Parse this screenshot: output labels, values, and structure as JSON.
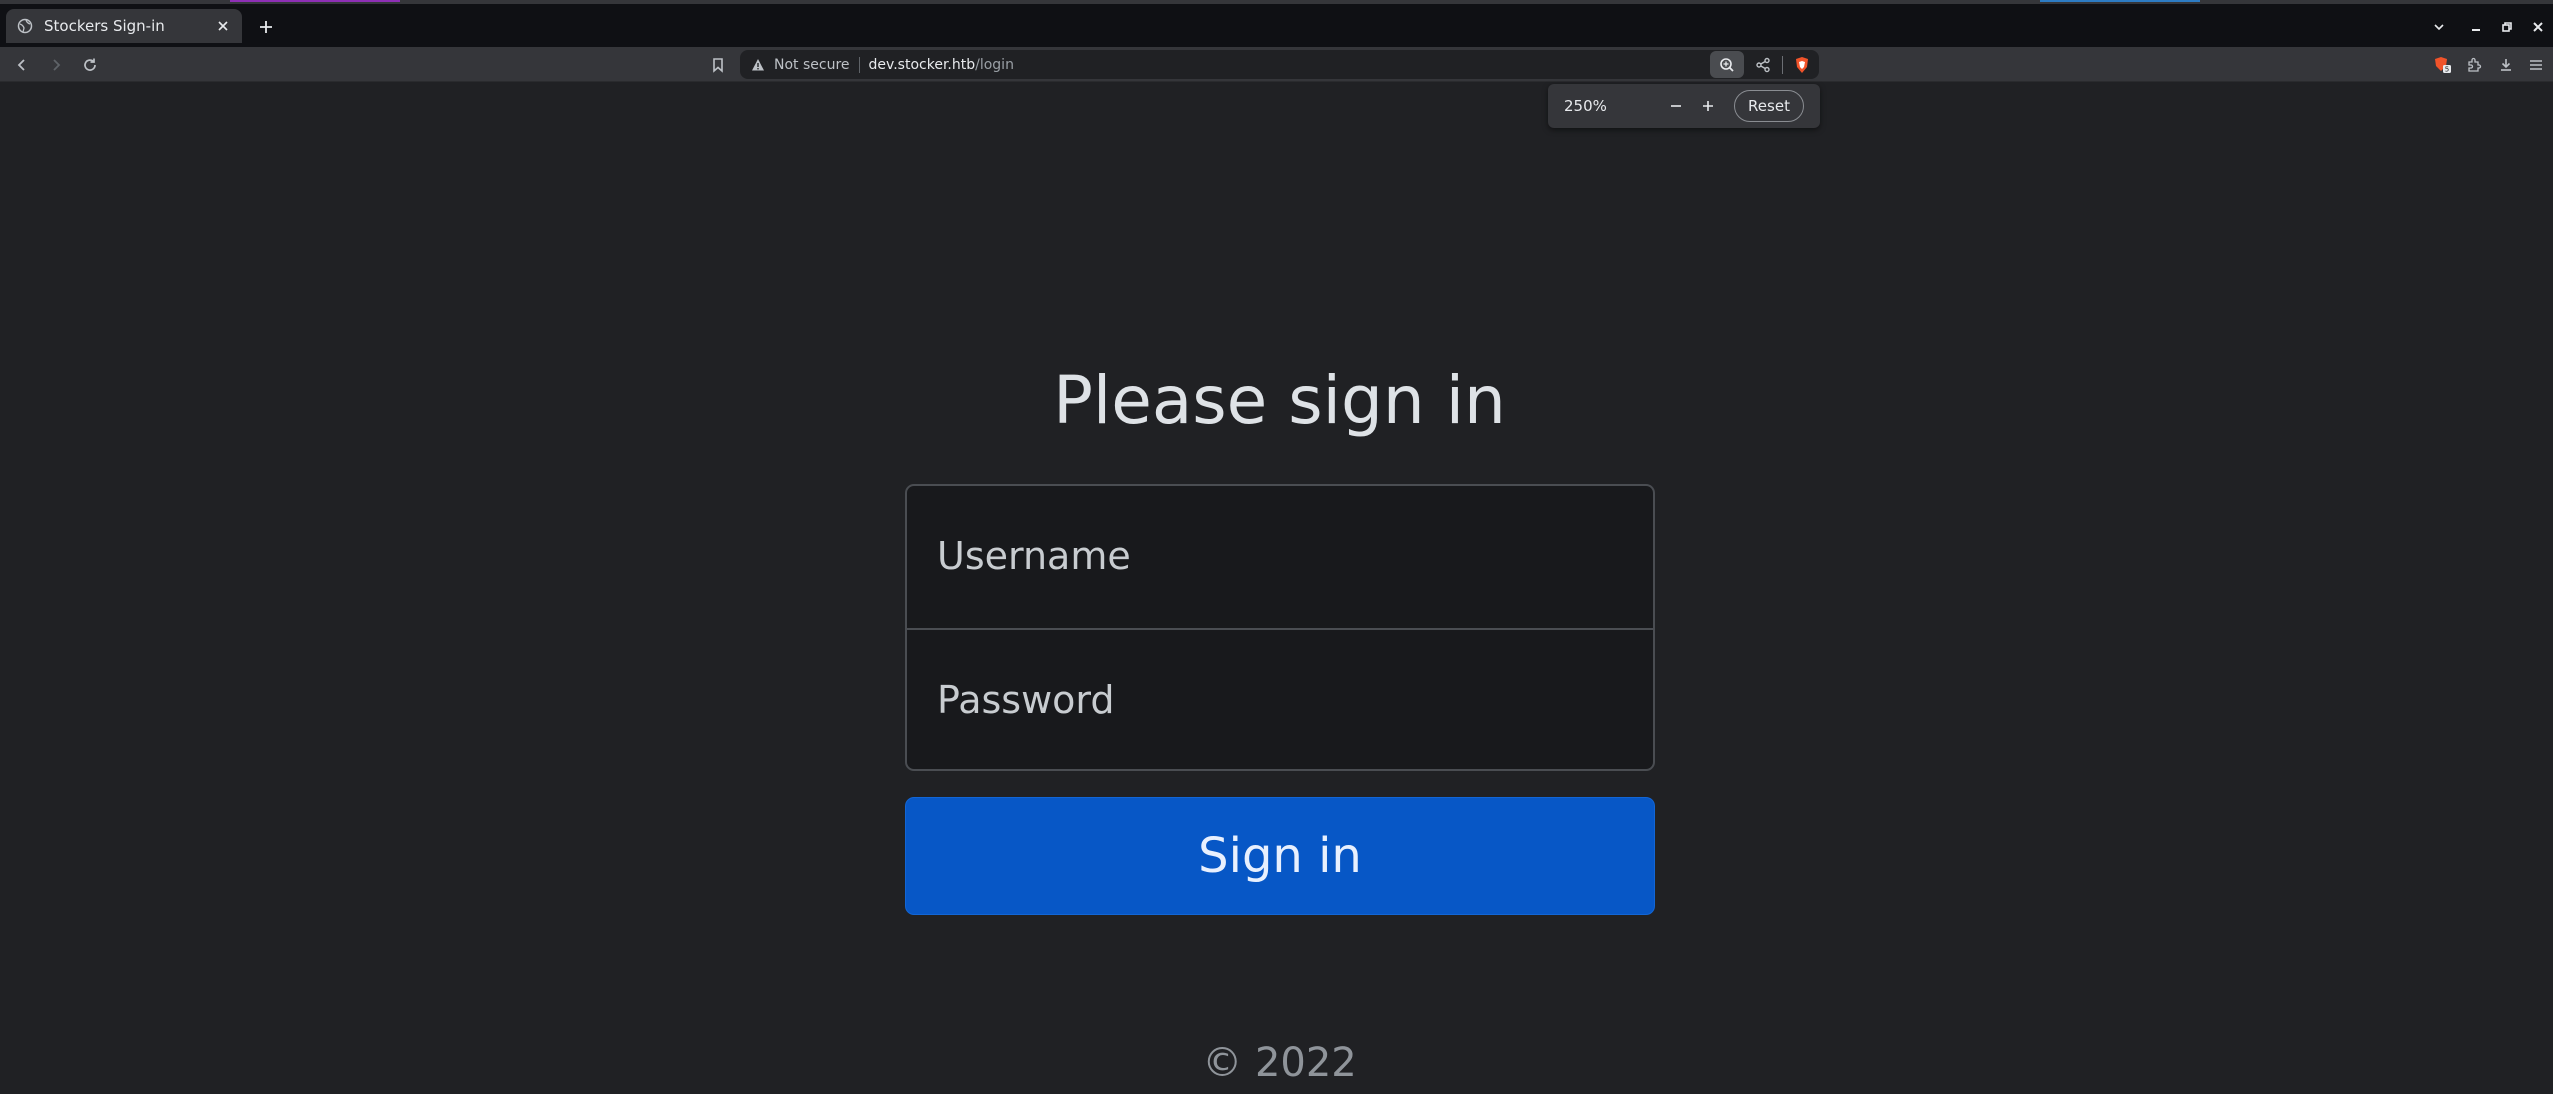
{
  "browser": {
    "tab": {
      "title": "Stockers Sign-in"
    },
    "address": {
      "security_label": "Not secure",
      "host": "dev.stocker.htb",
      "path": "/login"
    },
    "zoom": {
      "level": "250%",
      "reset_label": "Reset"
    },
    "extension_badge": "5"
  },
  "page": {
    "heading": "Please sign in",
    "username_placeholder": "Username",
    "password_placeholder": "Password",
    "submit_label": "Sign in",
    "footer": "© 2022"
  },
  "colors": {
    "page_bg": "#202124",
    "primary_button": "#0757c6",
    "warning_icon": "#bdc1c6"
  },
  "icons": [
    "globe-icon",
    "close-icon",
    "plus-icon",
    "chevron-down-icon",
    "minimize-icon",
    "maximize-icon",
    "back-icon",
    "forward-icon",
    "reload-icon",
    "bookmark-icon",
    "warning-icon",
    "zoom-icon",
    "share-icon",
    "brave-shield-icon",
    "brave-rewards-icon",
    "extensions-icon",
    "download-icon",
    "menu-icon"
  ]
}
